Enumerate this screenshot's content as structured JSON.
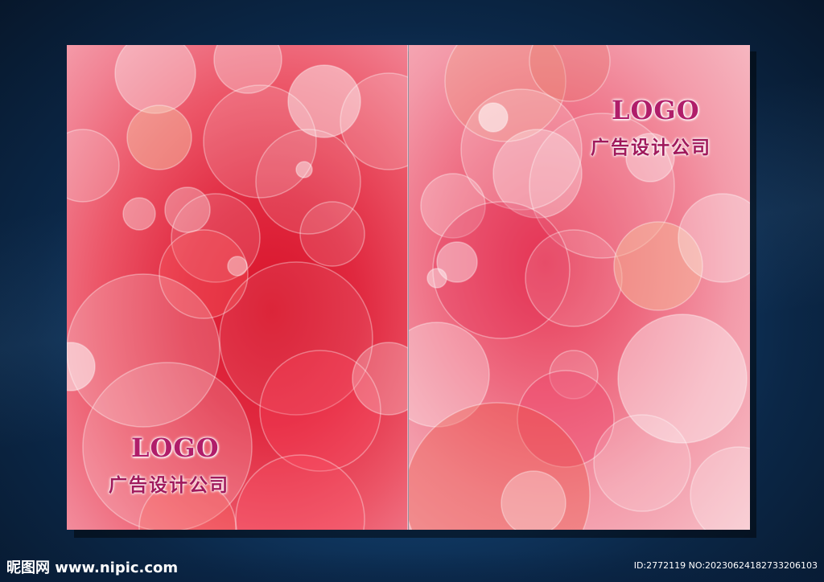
{
  "left_cover": {
    "logo": "LOGO",
    "company": "广告设计公司"
  },
  "right_cover": {
    "logo": "LOGO",
    "company": "广告设计公司"
  },
  "watermark": {
    "site": "昵图网 www.nipic.com",
    "id": "ID:2772119 NO:20230624182733206103"
  },
  "colors": {
    "background": "#0b2747",
    "cover_red": "#e0283f",
    "cover_pink": "#f39aa9",
    "logo_text": "#b01e6a"
  }
}
